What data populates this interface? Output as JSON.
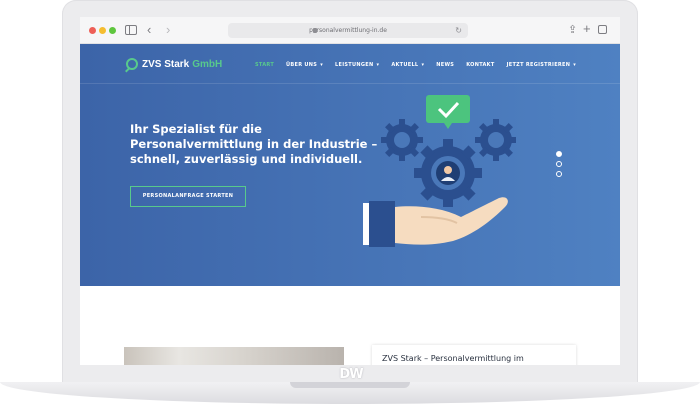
{
  "browser": {
    "url": "personalvermittlung-in.de",
    "traffic_lights": {
      "close": "#ee5f57",
      "minimize": "#f5bd30",
      "zoom": "#5fc63e"
    }
  },
  "site": {
    "brand_name": "ZVS Stark",
    "brand_suffix": "GmbH",
    "nav": [
      {
        "label": "START",
        "active": true
      },
      {
        "label": "ÜBER UNS",
        "dropdown": true
      },
      {
        "label": "LEISTUNGEN",
        "dropdown": true
      },
      {
        "label": "AKTUELL",
        "dropdown": true
      },
      {
        "label": "NEWS"
      },
      {
        "label": "KONTAKT"
      },
      {
        "label": "JETZT REGISTRIEREN",
        "dropdown": true
      }
    ],
    "hero": {
      "headline": "Ihr Spezialist für die Personalvermittlung in der Industrie – schnell, zuverlässig und individuell.",
      "cta_label": "PERSONALANFRAGE STARTEN",
      "slides_total": 3,
      "active_slide": 1
    },
    "card_title": "ZVS Stark – Personalvermittlung im",
    "colors": {
      "accent": "#58c98c",
      "hero_start": "#3c64a8",
      "hero_end": "#4f81c2"
    }
  },
  "device_logo_text": "DW"
}
